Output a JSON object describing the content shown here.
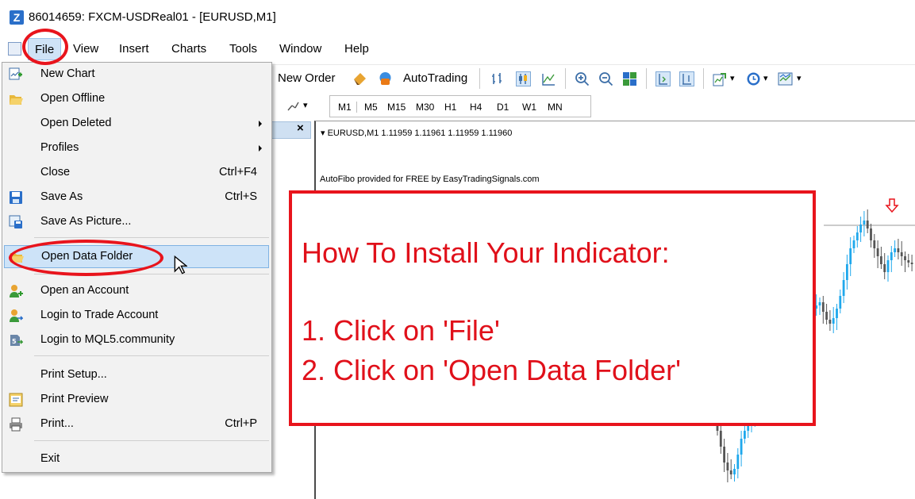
{
  "window": {
    "title": "86014659: FXCM-USDReal01 - [EURUSD,M1]"
  },
  "menubar": {
    "items": [
      "File",
      "View",
      "Insert",
      "Charts",
      "Tools",
      "Window",
      "Help"
    ]
  },
  "toolbar": {
    "new_order": "New Order",
    "autotrading": "AutoTrading",
    "timeframes": [
      "M1",
      "M5",
      "M15",
      "M30",
      "H1",
      "H4",
      "D1",
      "W1",
      "MN"
    ]
  },
  "file_menu": {
    "items": [
      {
        "label": "New Chart",
        "shortcut": "",
        "icon": "new-chart-icon"
      },
      {
        "label": "Open Offline",
        "shortcut": "",
        "icon": "open-folder-icon"
      },
      {
        "label": "Open Deleted",
        "shortcut": "",
        "submenu": true
      },
      {
        "label": "Profiles",
        "shortcut": "",
        "submenu": true
      },
      {
        "label": "Close",
        "shortcut": "Ctrl+F4"
      },
      {
        "label": "Save As",
        "shortcut": "Ctrl+S",
        "icon": "save-icon"
      },
      {
        "label": "Save As Picture...",
        "shortcut": "",
        "icon": "save-picture-icon"
      },
      {
        "label": "Open Data Folder",
        "shortcut": "",
        "icon": "folder-icon",
        "highlighted": true
      },
      {
        "label": "Open an Account",
        "shortcut": "",
        "icon": "account-add-icon"
      },
      {
        "label": "Login to Trade Account",
        "shortcut": "",
        "icon": "account-login-icon"
      },
      {
        "label": "Login to MQL5.community",
        "shortcut": "",
        "icon": "mql5-icon"
      },
      {
        "label": "Print Setup...",
        "shortcut": ""
      },
      {
        "label": "Print Preview",
        "shortcut": "",
        "icon": "print-preview-icon"
      },
      {
        "label": "Print...",
        "shortcut": "Ctrl+P",
        "icon": "printer-icon"
      },
      {
        "label": "Exit",
        "shortcut": ""
      }
    ]
  },
  "chart": {
    "symbol_line": "EURUSD,M1  1.11959 1.11961 1.11959 1.11960",
    "note": "AutoFibo provided for FREE by EasyTradingSignals.com"
  },
  "instructions": {
    "heading": "How To Install Your Indicator:",
    "step1": "1. Click on 'File'",
    "step2": "2. Click on 'Open Data Folder'"
  },
  "colors": {
    "annotation_red": "#e8141c",
    "candle_up": "#1fa8ec",
    "candle_down": "#555555",
    "menu_highlight": "#cde3f8"
  }
}
